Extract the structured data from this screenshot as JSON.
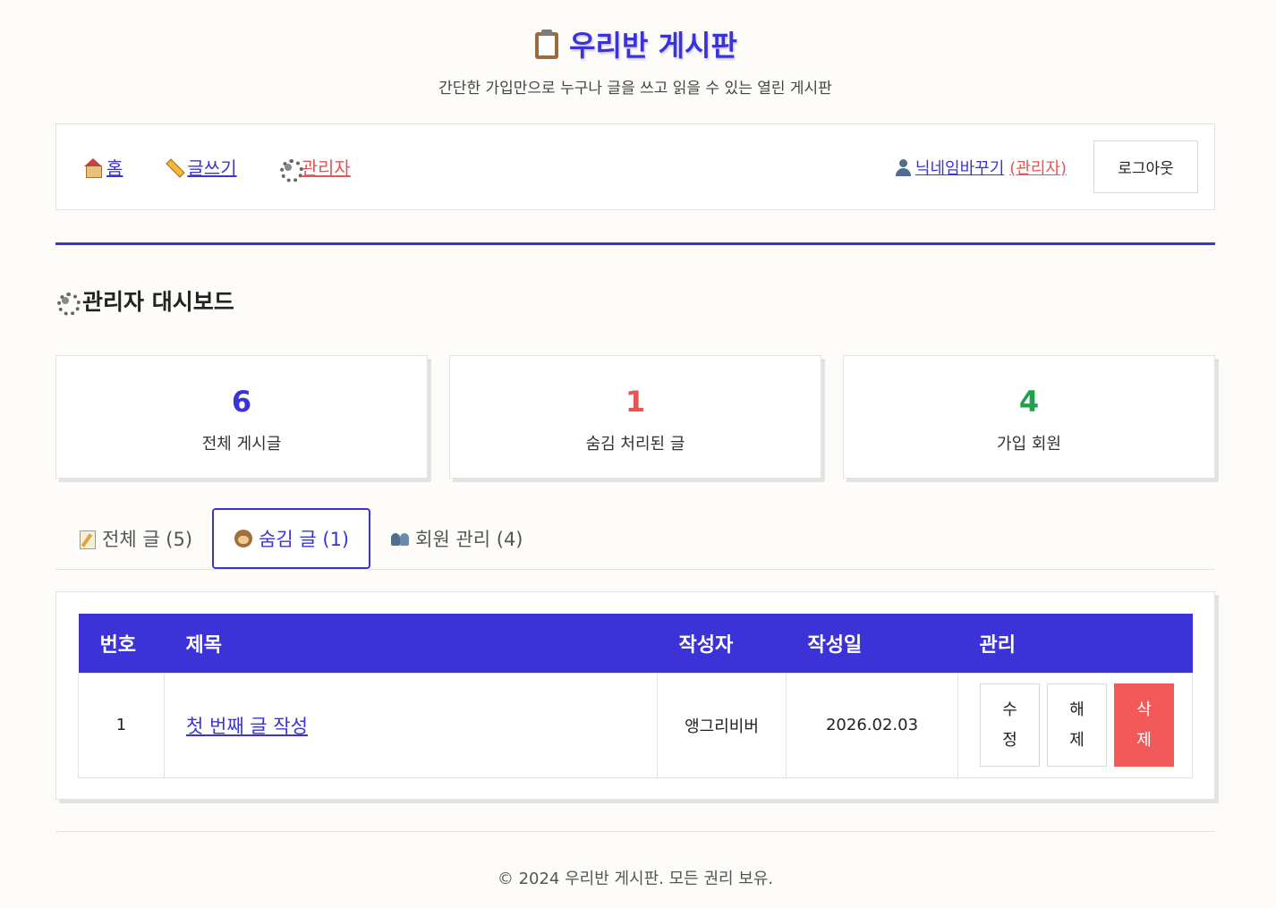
{
  "header": {
    "title": "우리반 게시판",
    "subtitle": "간단한 가입만으로 누구나 글을 쓰고 읽을 수 있는 열린 게시판"
  },
  "nav": {
    "home": "홈",
    "write": "글쓰기",
    "admin": "관리자",
    "user_name": "닉네임바꾸기",
    "user_role": "(관리자)",
    "logout": "로그아웃"
  },
  "dashboard": {
    "title": "관리자 대시보드",
    "stats": [
      {
        "value": "6",
        "label": "전체 게시글",
        "color": "#3b33d8"
      },
      {
        "value": "1",
        "label": "숨김 처리된 글",
        "color": "#e45555"
      },
      {
        "value": "4",
        "label": "가입 회원",
        "color": "#1fa34a"
      }
    ]
  },
  "tabs": [
    {
      "label": "전체 글 (5)",
      "icon": "memo-icon",
      "active": false
    },
    {
      "label": "숨김 글 (1)",
      "icon": "see-no-evil-monkey-icon",
      "active": true
    },
    {
      "label": "회원 관리 (4)",
      "icon": "people-icon",
      "active": false
    }
  ],
  "table": {
    "headers": [
      "번호",
      "제목",
      "작성자",
      "작성일",
      "관리"
    ],
    "rows": [
      {
        "number": "1",
        "title": "첫 번째 글 작성",
        "author": "앵그리비버",
        "date": "2026.02.03",
        "actions": [
          {
            "line1": "수",
            "line2": "정"
          },
          {
            "line1": "해",
            "line2": "제"
          },
          {
            "line1": "삭",
            "line2": "제"
          }
        ]
      }
    ]
  },
  "footer": {
    "text": "© 2024 우리반 게시판. 모든 권리 보유."
  },
  "colors": {
    "accent": "#3b33d8",
    "danger": "#e45555",
    "success": "#1fa34a",
    "background": "#fdfcf8"
  }
}
